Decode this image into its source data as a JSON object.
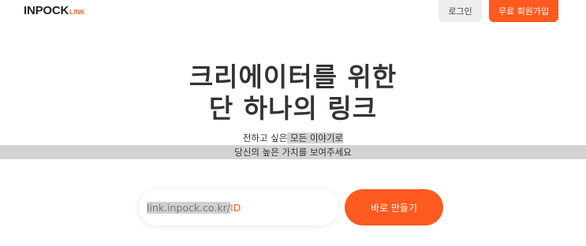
{
  "header": {
    "logo_main": "INPOCK",
    "logo_sub": "LINK",
    "login_label": "로그인",
    "signup_label": "무료 회원가입"
  },
  "hero": {
    "line1": "크리에이터를 위한",
    "line2": "단 하나의 링크"
  },
  "subtitle": {
    "line1_plain": "전하고 싶은",
    "line1_highlight": " 모든 이야기로",
    "line2": "당신의 높은 가치를 보여주세요"
  },
  "url_input": {
    "prefix": "link.inpock.co.kr/",
    "id_placeholder": "ID"
  },
  "cta": {
    "make_label": "바로 만들기"
  },
  "colors": {
    "accent": "#ff5a1f",
    "login_bg": "#eeeeee",
    "highlight": "#d2d2d2"
  }
}
